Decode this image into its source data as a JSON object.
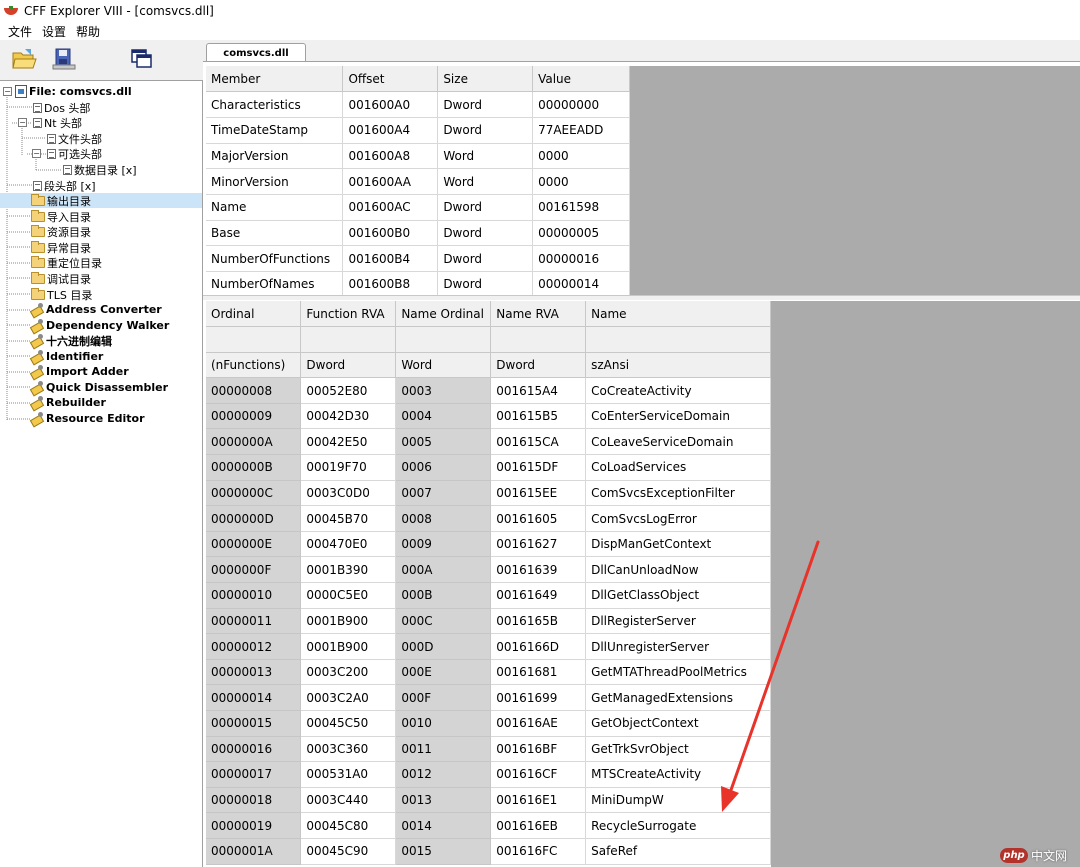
{
  "window": {
    "title": "CFF Explorer VIII - [comsvcs.dll]"
  },
  "menu": [
    "文件",
    "设置",
    "帮助"
  ],
  "toolbar": {
    "icons": [
      "open-file-icon",
      "save-file-icon",
      "windows-icon"
    ]
  },
  "tree": {
    "items": [
      {
        "label": "File: comsvcs.dll",
        "icon": "file-icon",
        "bold": true
      },
      {
        "label": "Dos 头部",
        "icon": "doc-icon"
      },
      {
        "label": "Nt 头部",
        "icon": "doc-icon"
      },
      {
        "label": "文件头部",
        "icon": "doc-icon"
      },
      {
        "label": "可选头部",
        "icon": "doc-icon"
      },
      {
        "label": "数据目录 [x]",
        "icon": "doc-icon"
      },
      {
        "label": "段头部 [x]",
        "icon": "doc-icon"
      },
      {
        "label": "输出目录",
        "icon": "folder-icon",
        "selected": true
      },
      {
        "label": "导入目录",
        "icon": "folder-icon"
      },
      {
        "label": "资源目录",
        "icon": "folder-icon"
      },
      {
        "label": "异常目录",
        "icon": "folder-icon"
      },
      {
        "label": "重定位目录",
        "icon": "folder-icon"
      },
      {
        "label": "调试目录",
        "icon": "folder-icon"
      },
      {
        "label": "TLS 目录",
        "icon": "folder-icon"
      },
      {
        "label": "Address Converter",
        "icon": "tool-icon",
        "bold": true
      },
      {
        "label": "Dependency Walker",
        "icon": "tool-icon",
        "bold": true
      },
      {
        "label": "十六进制编辑",
        "icon": "tool-icon",
        "bold": true
      },
      {
        "label": "Identifier",
        "icon": "tool-icon",
        "bold": true
      },
      {
        "label": "Import Adder",
        "icon": "tool-icon",
        "bold": true
      },
      {
        "label": "Quick Disassembler",
        "icon": "tool-icon",
        "bold": true
      },
      {
        "label": "Rebuilder",
        "icon": "tool-icon",
        "bold": true
      },
      {
        "label": "Resource Editor",
        "icon": "tool-icon",
        "bold": true
      }
    ]
  },
  "tab": {
    "label": "comsvcs.dll"
  },
  "export_header": {
    "columns": [
      "Member",
      "Offset",
      "Size",
      "Value"
    ],
    "rows": [
      [
        "Characteristics",
        "001600A0",
        "Dword",
        "00000000"
      ],
      [
        "TimeDateStamp",
        "001600A4",
        "Dword",
        "77AEEADD"
      ],
      [
        "MajorVersion",
        "001600A8",
        "Word",
        "0000"
      ],
      [
        "MinorVersion",
        "001600AA",
        "Word",
        "0000"
      ],
      [
        "Name",
        "001600AC",
        "Dword",
        "00161598"
      ],
      [
        "Base",
        "001600B0",
        "Dword",
        "00000005"
      ],
      [
        "NumberOfFunctions",
        "001600B4",
        "Dword",
        "00000016"
      ],
      [
        "NumberOfNames",
        "001600B8",
        "Dword",
        "00000014"
      ]
    ]
  },
  "exports": {
    "columns": [
      "Ordinal",
      "Function RVA",
      "Name Ordinal",
      "Name RVA",
      "Name"
    ],
    "types": [
      "(nFunctions)",
      "Dword",
      "Word",
      "Dword",
      "szAnsi"
    ],
    "rows": [
      [
        "00000008",
        "00052E80",
        "0003",
        "001615A4",
        "CoCreateActivity"
      ],
      [
        "00000009",
        "00042D30",
        "0004",
        "001615B5",
        "CoEnterServiceDomain"
      ],
      [
        "0000000A",
        "00042E50",
        "0005",
        "001615CA",
        "CoLeaveServiceDomain"
      ],
      [
        "0000000B",
        "00019F70",
        "0006",
        "001615DF",
        "CoLoadServices"
      ],
      [
        "0000000C",
        "0003C0D0",
        "0007",
        "001615EE",
        "ComSvcsExceptionFilter"
      ],
      [
        "0000000D",
        "00045B70",
        "0008",
        "00161605",
        "ComSvcsLogError"
      ],
      [
        "0000000E",
        "000470E0",
        "0009",
        "00161627",
        "DispManGetContext"
      ],
      [
        "0000000F",
        "0001B390",
        "000A",
        "00161639",
        "DllCanUnloadNow"
      ],
      [
        "00000010",
        "0000C5E0",
        "000B",
        "00161649",
        "DllGetClassObject"
      ],
      [
        "00000011",
        "0001B900",
        "000C",
        "0016165B",
        "DllRegisterServer"
      ],
      [
        "00000012",
        "0001B900",
        "000D",
        "0016166D",
        "DllUnregisterServer"
      ],
      [
        "00000013",
        "0003C200",
        "000E",
        "00161681",
        "GetMTAThreadPoolMetrics"
      ],
      [
        "00000014",
        "0003C2A0",
        "000F",
        "00161699",
        "GetManagedExtensions"
      ],
      [
        "00000015",
        "00045C50",
        "0010",
        "001616AE",
        "GetObjectContext"
      ],
      [
        "00000016",
        "0003C360",
        "0011",
        "001616BF",
        "GetTrkSvrObject"
      ],
      [
        "00000017",
        "000531A0",
        "0012",
        "001616CF",
        "MTSCreateActivity"
      ],
      [
        "00000018",
        "0003C440",
        "0013",
        "001616E1",
        "MiniDumpW"
      ],
      [
        "00000019",
        "00045C80",
        "0014",
        "001616EB",
        "RecycleSurrogate"
      ],
      [
        "0000001A",
        "00045C90",
        "0015",
        "001616FC",
        "SafeRef"
      ]
    ]
  },
  "annotation": {
    "color": "#e8332a"
  },
  "watermark": {
    "badge": "php",
    "text": "中文网"
  }
}
